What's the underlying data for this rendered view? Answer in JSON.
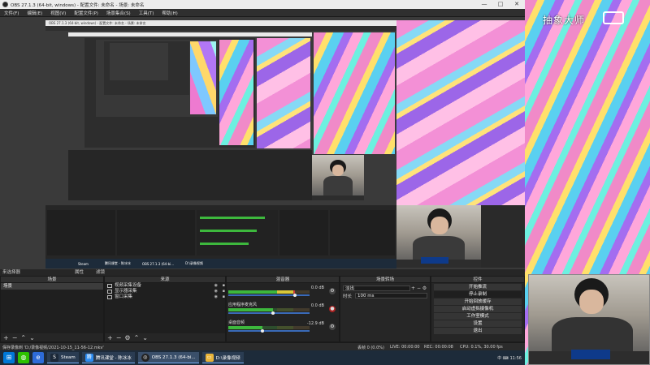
{
  "window": {
    "title": "OBS 27.1.3 (64-bit, windows) - 配置文件: 未命名 - 场景: 未命名",
    "controls": [
      "—",
      "□",
      "✕"
    ]
  },
  "menu": [
    "文件(F)",
    "编辑(E)",
    "视图(V)",
    "配置文件(P)",
    "场景集合(S)",
    "工具(T)",
    "帮助(H)"
  ],
  "nested": {
    "title_bar": "OBS 27.1.3 (64-bit, windows) - 配置文件: 未命名 - 场景: 未命名",
    "taskbar_items": [
      "Steam",
      "腾讯课堂 - 陈冰冰",
      "OBS 27.1.3 (64-bi...",
      "D:\\录像视频"
    ]
  },
  "dock_titles": {
    "scenes": "来选择器",
    "filter_btn": "属性",
    "filters_label": "滤镜"
  },
  "scenes": {
    "header": "场景",
    "items": [
      "场景"
    ]
  },
  "sources": {
    "header": "来源",
    "items": [
      {
        "label": "视频采集设备",
        "icon": "camera-icon"
      },
      {
        "label": "显示器采集",
        "icon": "monitor-icon"
      },
      {
        "label": "窗口采集",
        "icon": "window-icon"
      }
    ]
  },
  "mixer": {
    "header": "混音器",
    "channels": [
      {
        "label": "",
        "db": "0.0 dB",
        "level": 0.82
      },
      {
        "label": "应用程序麦克风",
        "db": "0.0 dB",
        "level": 0.55
      },
      {
        "label": "桌面音频",
        "db": "-12.9 dB",
        "level": 0.42
      }
    ]
  },
  "transitions": {
    "header": "场景转场",
    "type": "淡出",
    "duration_label": "时长",
    "duration_value": "100 ms"
  },
  "controls": {
    "header": "控件",
    "buttons": [
      "开始推流",
      "停止录制",
      "开始回放缓存",
      "启动虚拟摄像机",
      "工作室模式",
      "设置",
      "退出"
    ],
    "active_index": 1
  },
  "status": {
    "recording_path": "保存录像到 'D:/录像视频/2021-10-15_11-56-12.mkv'",
    "dropped": "丢帧 0 (0.0%)",
    "live": "LIVE: 00:00:00",
    "rec": "REC: 00:00:08",
    "cpu": "CPU: 0.1%, 30.00 fps"
  },
  "taskbar": {
    "tasks": [
      {
        "label": "Steam",
        "icon": "steam-icon",
        "color": "#1b2838"
      },
      {
        "label": "腾讯课堂 - 陈冰冰",
        "icon": "tencent-classroom-icon",
        "color": "#2d8cf0"
      },
      {
        "label": "OBS 27.1.3 (64-bi...",
        "icon": "obs-icon",
        "color": "#222222"
      },
      {
        "label": "D:\\录像视频",
        "icon": "folder-icon",
        "color": "#e8b43a"
      }
    ],
    "tray": "中 ⌨ 11:56"
  },
  "stream": {
    "watermark": "抽象大师"
  }
}
